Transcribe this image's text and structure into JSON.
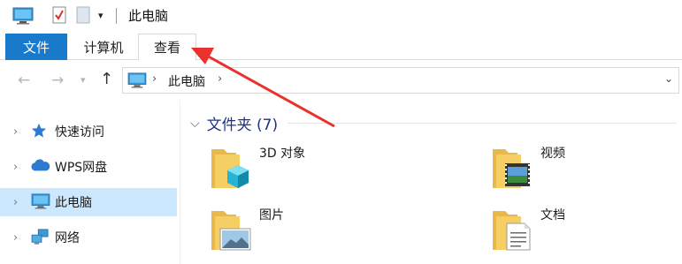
{
  "window": {
    "title": "此电脑"
  },
  "ribbon": {
    "tabs": [
      {
        "label": "文件"
      },
      {
        "label": "计算机"
      },
      {
        "label": "查看"
      }
    ]
  },
  "address": {
    "crumbs": [
      "此电脑"
    ]
  },
  "nav_pane": {
    "items": [
      {
        "label": "快速访问",
        "icon": "star-icon"
      },
      {
        "label": "WPS网盘",
        "icon": "cloud-icon"
      },
      {
        "label": "此电脑",
        "icon": "computer-icon",
        "selected": true
      },
      {
        "label": "网络",
        "icon": "network-icon"
      }
    ]
  },
  "content": {
    "group_title": "文件夹 (7)",
    "folders": [
      {
        "name": "3D 对象",
        "icon": "3d-objects-folder-icon"
      },
      {
        "name": "视频",
        "icon": "videos-folder-icon"
      },
      {
        "name": "图片",
        "icon": "pictures-folder-icon"
      },
      {
        "name": "文档",
        "icon": "documents-folder-icon"
      }
    ]
  },
  "colors": {
    "file_tab": "#1979ca",
    "selection": "#cce8ff",
    "group_title": "#1e3287",
    "annotation_arrow": "#e8322e"
  }
}
